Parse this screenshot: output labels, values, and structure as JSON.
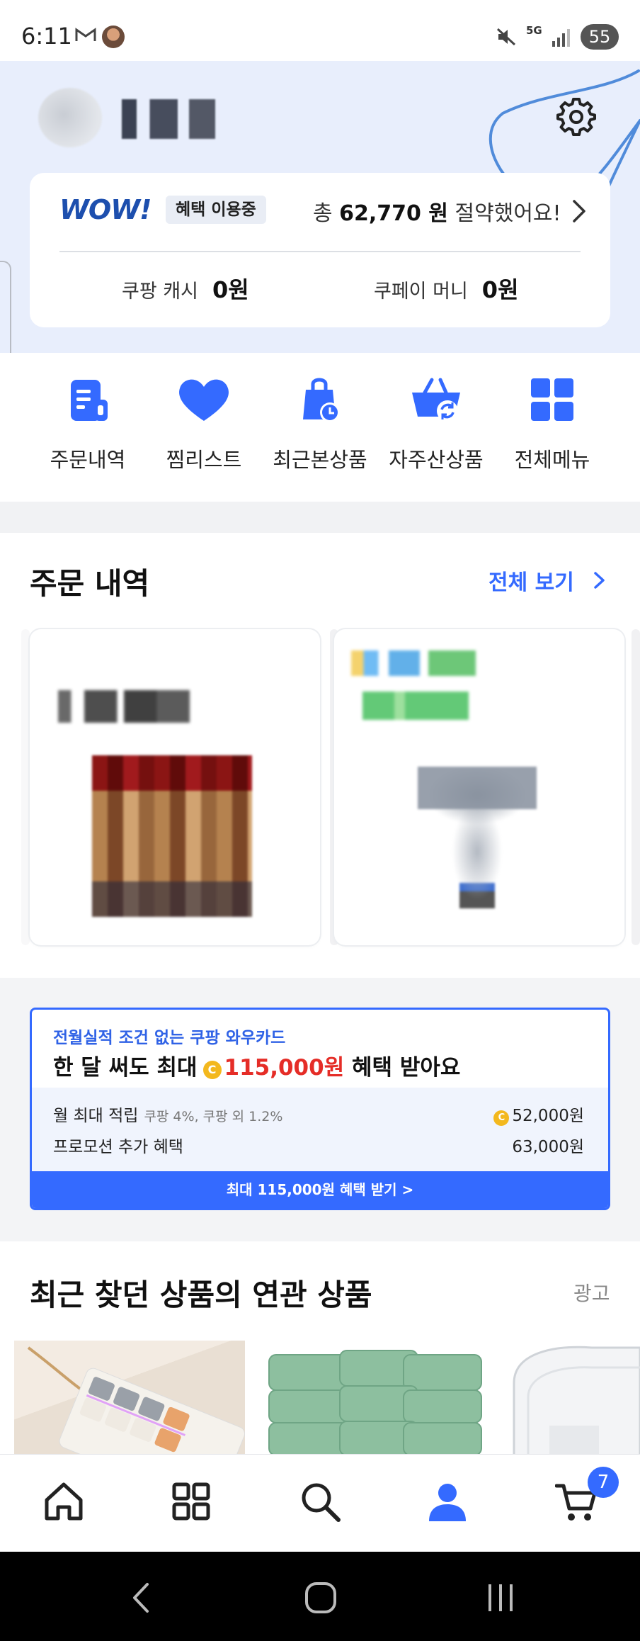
{
  "status_bar": {
    "time": "6:11",
    "battery": "55",
    "network": "5G"
  },
  "header": {
    "wow": {
      "logo": "WOW!",
      "badge": "혜택 이용중",
      "savings_prefix": "총",
      "savings_amount": "62,770 원",
      "savings_suffix": "절약했어요!"
    },
    "cash": [
      {
        "label": "쿠팡 캐시",
        "value": "0원"
      },
      {
        "label": "쿠페이 머니",
        "value": "0원"
      }
    ]
  },
  "quick_menu": [
    {
      "label": "주문내역",
      "icon": "receipt-icon"
    },
    {
      "label": "찜리스트",
      "icon": "heart-icon"
    },
    {
      "label": "최근본상품",
      "icon": "recent-bag-icon"
    },
    {
      "label": "자주산상품",
      "icon": "reorder-basket-icon"
    },
    {
      "label": "전체메뉴",
      "icon": "grid-icon"
    }
  ],
  "orders": {
    "title": "주문 내역",
    "view_all": "전체 보기"
  },
  "promo": {
    "subtitle": "전월실적 조건 없는 쿠팡 와우카드",
    "headline_prefix": "한 달 써도 최대",
    "headline_amount": "115,000원",
    "headline_suffix": "혜택 받아요",
    "row1_label": "월 최대 적립",
    "row1_note": "쿠팡 4%, 쿠팡 외 1.2%",
    "row1_value": "52,000원",
    "row2_label": "프로모션 추가 혜택",
    "row2_value": "63,000원",
    "cta": "최대 115,000원 혜택 받기 >"
  },
  "related": {
    "title": "최근 찾던 상품의 연관 상품",
    "ad_label": "광고"
  },
  "bottom_nav": {
    "cart_count": "7"
  },
  "colors": {
    "accent": "#346aff",
    "panel_bg": "#e8eefc",
    "highlight_red": "#e52d27",
    "coin": "#f3b81e"
  }
}
